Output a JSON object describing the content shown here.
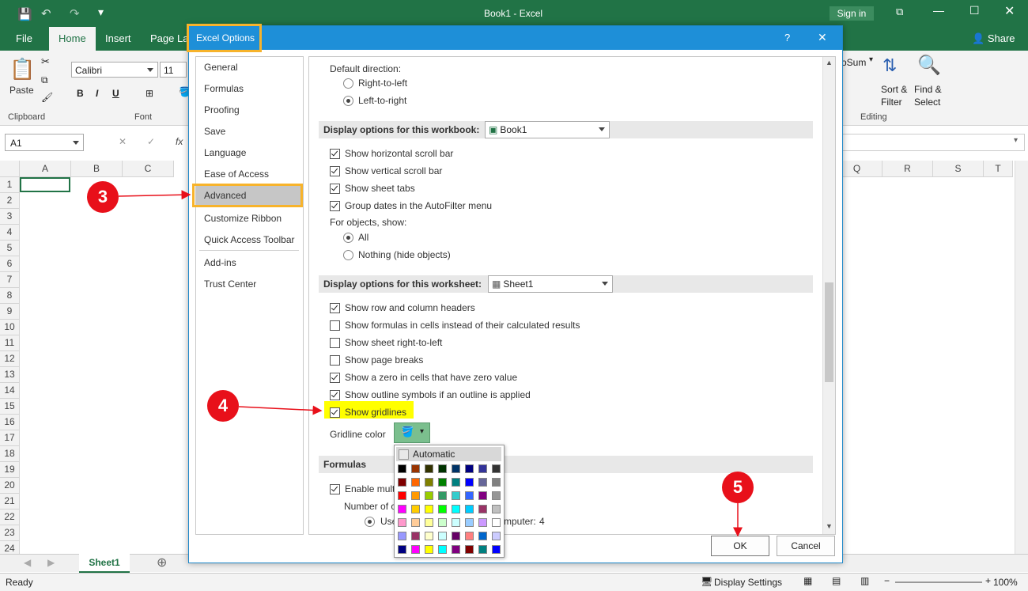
{
  "window": {
    "title": "Book1  -  Excel",
    "sign_in": "Sign in",
    "share": "Share"
  },
  "ribbon_tabs": [
    "File",
    "Home",
    "Insert",
    "Page Lay"
  ],
  "ribbon": {
    "paste": "Paste",
    "clipboard": "Clipboard",
    "font_name": "Calibri",
    "font_size": "11",
    "bold": "B",
    "italic": "I",
    "underline": "U",
    "font_group": "Font",
    "autosum": "oSum",
    "sort_filter": "Sort &",
    "sort_filter2": "Filter",
    "find_select": "Find &",
    "find_select2": "Select",
    "editing": "Editing"
  },
  "formula_bar": {
    "name_box": "A1",
    "fx": "fx"
  },
  "grid": {
    "left_columns": [
      "A",
      "B",
      "C"
    ],
    "right_columns": [
      "Q",
      "R",
      "S",
      "T"
    ],
    "rows": [
      "1",
      "2",
      "3",
      "4",
      "5",
      "6",
      "7",
      "8",
      "9",
      "10",
      "11",
      "12",
      "13",
      "14",
      "15",
      "16",
      "17",
      "18",
      "19",
      "20",
      "21",
      "22",
      "23",
      "24"
    ]
  },
  "sheet_tab": "Sheet1",
  "status": {
    "ready": "Ready",
    "display_settings": "Display Settings",
    "zoom": "100%"
  },
  "dialog": {
    "title": "Excel Options",
    "help": "?",
    "close": "✕",
    "nav": [
      "General",
      "Formulas",
      "Proofing",
      "Save",
      "Language",
      "Ease of Access",
      "Advanced",
      "Customize Ribbon",
      "Quick Access Toolbar",
      "Add-ins",
      "Trust Center"
    ],
    "default_direction": "Default direction:",
    "rtl": "Right-to-left",
    "ltr": "Left-to-right",
    "workbook_section": "Display options for this workbook:",
    "workbook_value": "Book1",
    "workbook_opts": [
      "Show horizontal scroll bar",
      "Show vertical scroll bar",
      "Show sheet tabs",
      "Group dates in the AutoFilter menu"
    ],
    "for_objects": "For objects, show:",
    "all": "All",
    "nothing": "Nothing (hide objects)",
    "worksheet_section": "Display options for this worksheet:",
    "worksheet_value": "Sheet1",
    "worksheet_opts": [
      "Show row and column headers",
      "Show formulas in cells instead of their calculated results",
      "Show sheet right-to-left",
      "Show page breaks",
      "Show a zero in cells that have zero value",
      "Show outline symbols if an outline is applied",
      "Show gridlines"
    ],
    "gridline_color": "Gridline color",
    "formulas_section": "Formulas",
    "enable_multi": "Enable mult",
    "number_of": "Number of c",
    "use": "Use",
    "computer": "mputer:",
    "threads": "4",
    "ok": "OK",
    "cancel": "Cancel"
  },
  "palette": {
    "automatic": "Automatic",
    "colors": [
      [
        "#000000",
        "#993300",
        "#333300",
        "#003300",
        "#003366",
        "#000080",
        "#333399",
        "#333333"
      ],
      [
        "#800000",
        "#FF6600",
        "#808000",
        "#008000",
        "#008080",
        "#0000FF",
        "#666699",
        "#808080"
      ],
      [
        "#FF0000",
        "#FF9900",
        "#99CC00",
        "#339966",
        "#33CCCC",
        "#3366FF",
        "#800080",
        "#969696"
      ],
      [
        "#FF00FF",
        "#FFCC00",
        "#FFFF00",
        "#00FF00",
        "#00FFFF",
        "#00CCFF",
        "#993366",
        "#C0C0C0"
      ],
      [
        "#FF99CC",
        "#FFCC99",
        "#FFFF99",
        "#CCFFCC",
        "#CCFFFF",
        "#99CCFF",
        "#CC99FF",
        "#FFFFFF"
      ],
      [
        "#9999FF",
        "#993366",
        "#FFFFCC",
        "#CCFFFF",
        "#660066",
        "#FF8080",
        "#0066CC",
        "#CCCCFF"
      ],
      [
        "#000080",
        "#FF00FF",
        "#FFFF00",
        "#00FFFF",
        "#800080",
        "#800000",
        "#008080",
        "#0000FF"
      ]
    ]
  },
  "annotations": [
    "3",
    "4",
    "5"
  ],
  "colors": {
    "excel_green": "#217346",
    "dialog_blue": "#1e8fd8",
    "highlight": "#f7b32b",
    "badge_red": "#e8101a"
  }
}
